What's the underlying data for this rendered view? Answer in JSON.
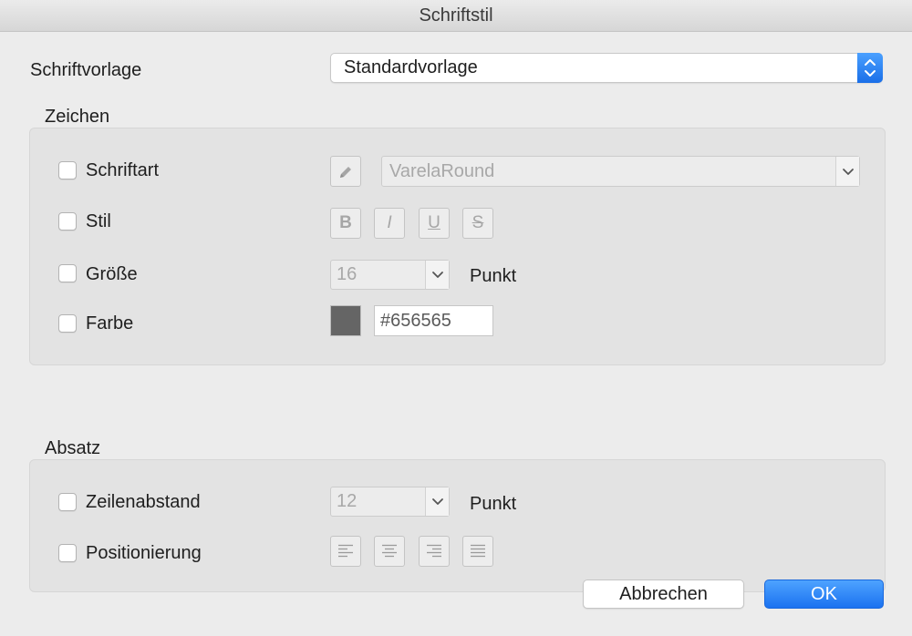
{
  "window": {
    "title": "Schriftstil"
  },
  "template": {
    "label": "Schriftvorlage",
    "selected": "Standardvorlage",
    "stepper_icon": "up-down-chevron-icon"
  },
  "character": {
    "section_label": "Zeichen",
    "font": {
      "label": "Schriftart",
      "checked": false,
      "edit_icon": "pencil-icon",
      "value": "VarelaRound",
      "dropdown_icon": "chevron-down-icon"
    },
    "style": {
      "label": "Stil",
      "checked": false,
      "bold": "B",
      "italic": "I",
      "underline": "U",
      "strikethrough": "S"
    },
    "size": {
      "label": "Größe",
      "checked": false,
      "value": "16",
      "unit": "Punkt"
    },
    "color": {
      "label": "Farbe",
      "checked": false,
      "hex": "#656565",
      "swatch_color": "#656565"
    }
  },
  "paragraph": {
    "section_label": "Absatz",
    "line_spacing": {
      "label": "Zeilenabstand",
      "checked": false,
      "value": "12",
      "unit": "Punkt"
    },
    "alignment": {
      "label": "Positionierung",
      "checked": false,
      "options": [
        "align-left-icon",
        "align-center-icon",
        "align-right-icon",
        "align-justify-icon"
      ]
    }
  },
  "buttons": {
    "cancel": "Abbrechen",
    "ok": "OK"
  },
  "colors": {
    "accent": "#1b72f0",
    "background": "#ececec",
    "group_background": "#e3e3e3"
  }
}
